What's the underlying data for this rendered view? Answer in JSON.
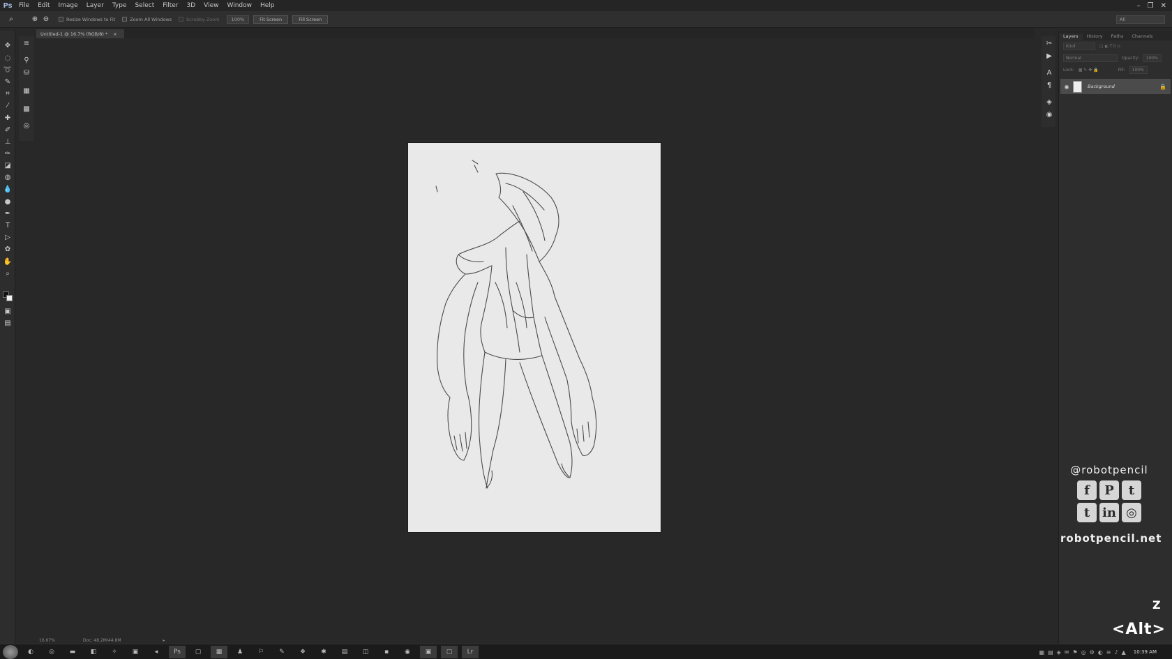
{
  "menubar": {
    "logo": "Ps",
    "items": [
      "File",
      "Edit",
      "Image",
      "Layer",
      "Type",
      "Select",
      "Filter",
      "3D",
      "View",
      "Window",
      "Help"
    ]
  },
  "options": {
    "resize_windows": "Resize Windows to Fit",
    "zoom_all": "Zoom All Windows",
    "scrubby": "Scrubby Zoom",
    "zoom_value": "100%",
    "fit_screen": "Fit Screen",
    "fill_screen": "Fill Screen",
    "workspace": "All"
  },
  "document": {
    "tab_title": "Untitled-1 @ 16.7% (RGB/8) *",
    "close": "×"
  },
  "status": {
    "zoom": "16.67%",
    "doc": "Doc: 48.2M/44.8M"
  },
  "panel": {
    "tabs": [
      "Layers",
      "History",
      "Paths",
      "Channels"
    ],
    "kind_label": "Kind",
    "blend_mode": "Normal",
    "opacity_label": "Opacity:",
    "opacity_value": "100%",
    "lock_label": "Lock:",
    "fill_label": "Fill:",
    "fill_value": "100%",
    "layer_name": "Background"
  },
  "overlay": {
    "handle": "@robotpencil",
    "site": "robotpencil.net",
    "key_z": "Z",
    "key_alt": "<Alt>",
    "social_icons": [
      "facebook-icon",
      "pinterest-icon",
      "twitter-icon",
      "tumblr-icon",
      "linkedin-icon",
      "instagram-icon"
    ]
  },
  "taskbar": {
    "clock": "10:39 AM"
  },
  "colors": {
    "workspace_bg": "#282828",
    "canvas_paper": "#e9e9e9",
    "panel_bg": "#2d2d2d"
  }
}
